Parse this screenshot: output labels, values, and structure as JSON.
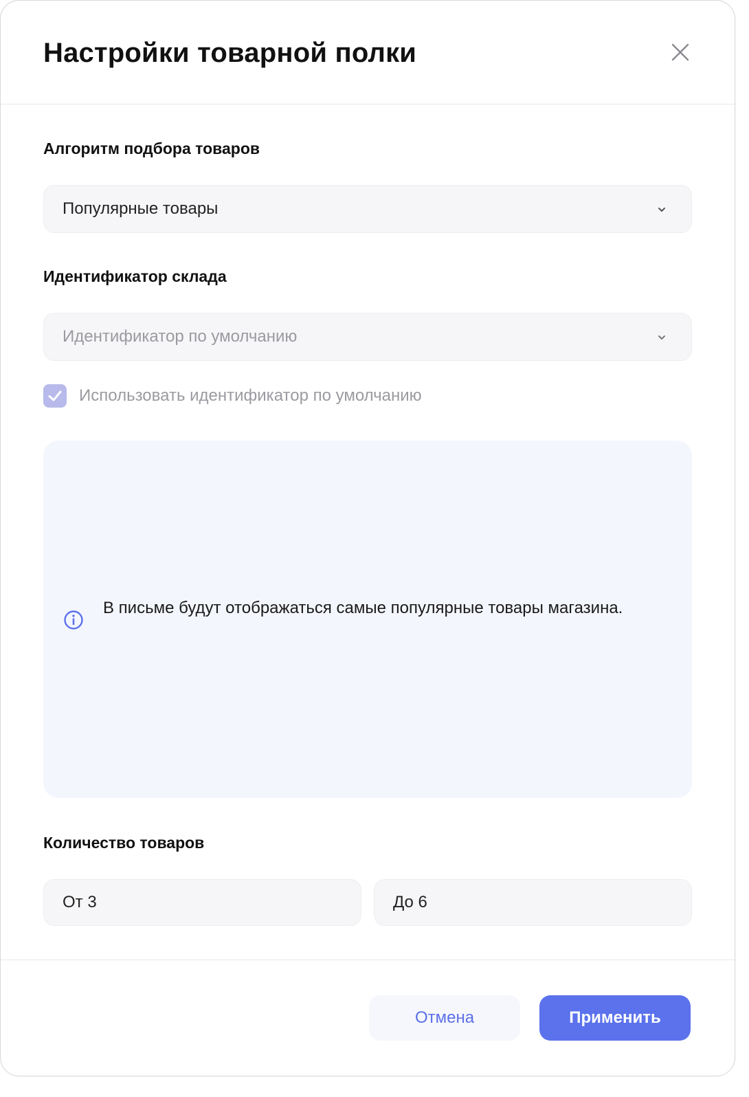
{
  "dialog": {
    "title": "Настройки товарной полки"
  },
  "algorithm": {
    "label": "Алгоритм подбора товаров",
    "selected": "Популярные товары"
  },
  "warehouse": {
    "label": "Идентификатор склада",
    "selected": "Идентификатор по умолчанию",
    "use_default_label": "Использовать идентификатор по умолчанию",
    "use_default_checked": true
  },
  "info": {
    "text": "В письме будут отображаться самые популярные товары магазина."
  },
  "quantity": {
    "label": "Количество товаров",
    "from": "От 3",
    "to": "До 6"
  },
  "footer": {
    "cancel_label": "Отмена",
    "apply_label": "Применить"
  },
  "colors": {
    "accent": "#5b72ec",
    "accent_text": "#5c6fe6",
    "info_bg": "#f4f6fe",
    "checkbox_disabled": "#b7baea",
    "field_bg": "#f6f6f8"
  },
  "icons": {
    "close": "close-icon",
    "chevron": "chevron-down-icon",
    "check": "check-icon",
    "info": "info-icon"
  }
}
